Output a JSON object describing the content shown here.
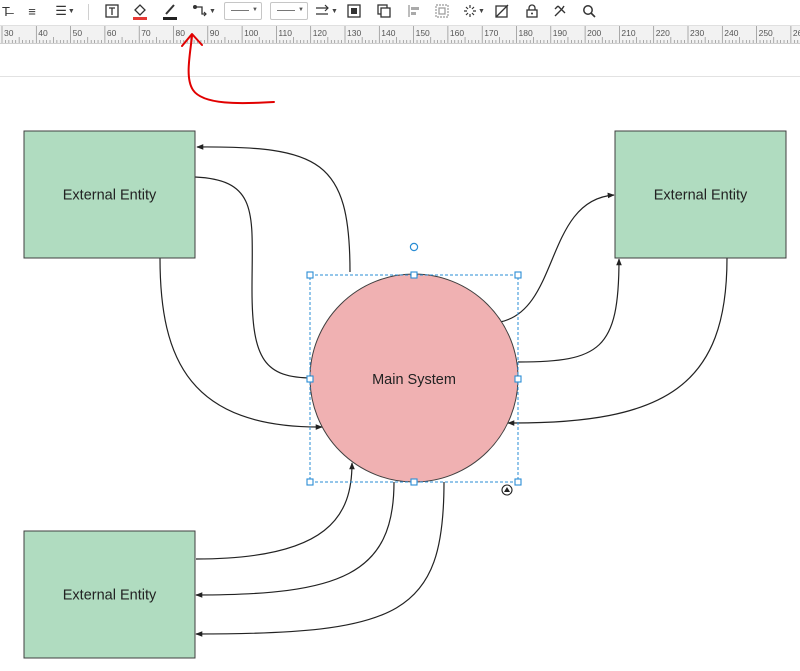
{
  "toolbar": {
    "tools": [
      {
        "name": "text-style-icon",
        "glyph": "T̶"
      },
      {
        "name": "align-icon",
        "glyph": "≡"
      },
      {
        "name": "line-spacing-icon",
        "glyph": "☰"
      },
      {
        "name": "text-box-icon",
        "glyph": "T"
      },
      {
        "name": "fill-color-icon",
        "glyph": "◈"
      },
      {
        "name": "line-color-icon",
        "glyph": "✎"
      },
      {
        "name": "connector-style-icon",
        "glyph": "↴"
      },
      {
        "name": "arrow-style-icon",
        "glyph": "⇄"
      },
      {
        "name": "bring-front-icon",
        "glyph": "❐"
      },
      {
        "name": "send-back-icon",
        "glyph": "❏"
      },
      {
        "name": "align-left-icon",
        "glyph": "⊫"
      },
      {
        "name": "group-icon",
        "glyph": "⊡"
      },
      {
        "name": "effects-icon",
        "glyph": "✲"
      },
      {
        "name": "no-style-icon",
        "glyph": "⊘"
      },
      {
        "name": "lock-icon",
        "glyph": "🔒"
      },
      {
        "name": "tools-icon",
        "glyph": "✂"
      },
      {
        "name": "search-icon",
        "glyph": "⌕"
      }
    ]
  },
  "ruler": {
    "labels": [
      "30",
      "40",
      "50",
      "60",
      "70",
      "80",
      "90",
      "100",
      "110",
      "120",
      "130",
      "140",
      "150",
      "160",
      "170",
      "180",
      "190",
      "200",
      "210",
      "220",
      "230",
      "240",
      "250",
      "26"
    ]
  },
  "diagram": {
    "entities": [
      {
        "id": "top-left",
        "label": "External Entity"
      },
      {
        "id": "top-right",
        "label": "External Entity"
      },
      {
        "id": "bottom-left",
        "label": "External Entity"
      }
    ],
    "system": {
      "label": "Main System"
    },
    "colors": {
      "entity_fill": "#b0dcc0",
      "entity_stroke": "#3f3f3f",
      "system_fill": "#f0b1b2",
      "system_stroke": "#3f3f3f",
      "selection": "#2a8dd4",
      "annotation_arrow": "#e10000"
    }
  }
}
